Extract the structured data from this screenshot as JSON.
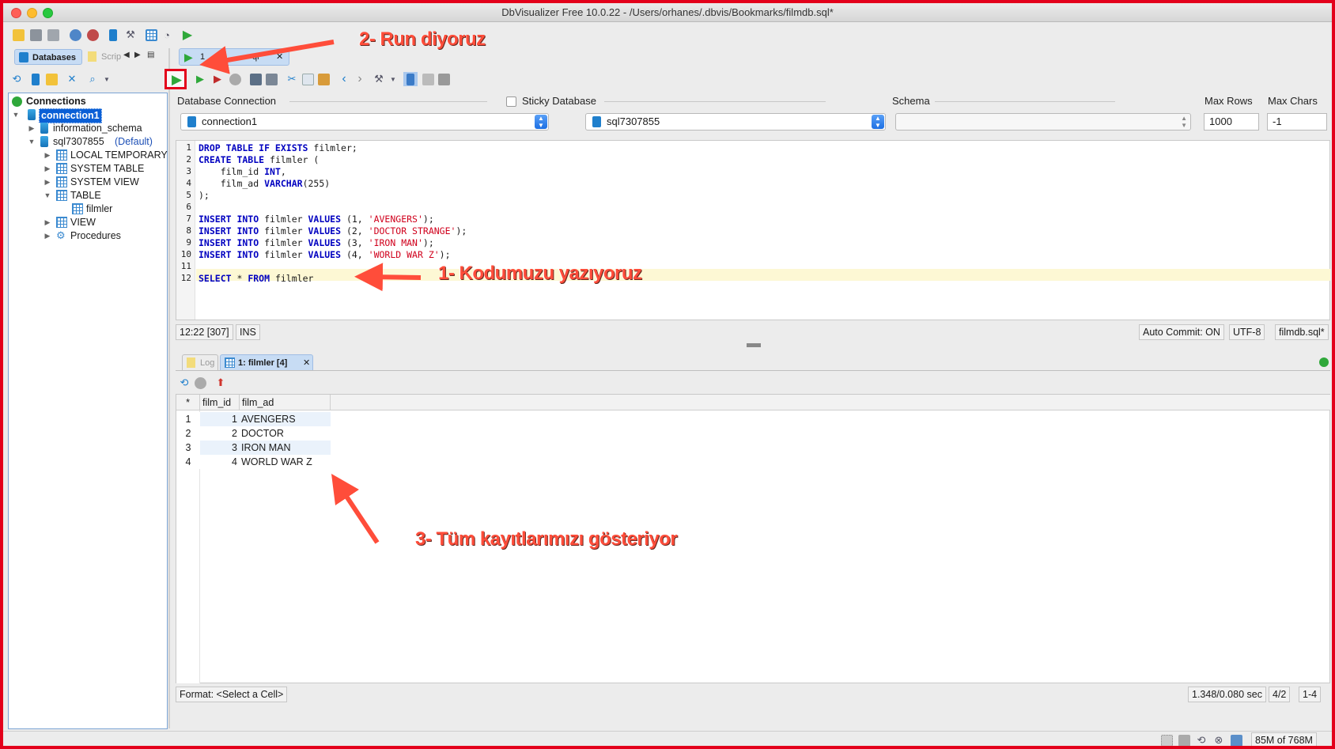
{
  "window": {
    "title": "DbVisualizer Free 10.0.22 - /Users/orhanes/.dbvis/Bookmarks/filmdb.sql*"
  },
  "left_tabs": {
    "databases": "Databases",
    "scripts": "Scrip"
  },
  "tree": {
    "root": "Connections",
    "connection": "connection1",
    "schema1": "information_schema",
    "schema2": "sql7307855",
    "schema2_default": "(Default)",
    "items": [
      "LOCAL TEMPORARY",
      "SYSTEM TABLE",
      "SYSTEM VIEW",
      "TABLE",
      "VIEW",
      "Procedures"
    ],
    "table_child": "filmler"
  },
  "editor_tab": {
    "label": "1",
    "label_suffix": "ql"
  },
  "connection_bar": {
    "database_connection_label": "Database Connection",
    "database_connection_value": "connection1",
    "sticky_label": "Sticky Database",
    "database_value": "sql7307855",
    "schema_label": "Schema",
    "schema_value": "",
    "max_rows_label": "Max Rows",
    "max_rows_value": "1000",
    "max_chars_label": "Max Chars",
    "max_chars_value": "-1"
  },
  "editor": {
    "line_numbers": [
      "1",
      "2",
      "3",
      "4",
      "5",
      "6",
      "7",
      "8",
      "9",
      "10",
      "11",
      "12"
    ],
    "lines": [
      [
        {
          "k": "DROP TABLE IF EXISTS"
        },
        {
          "t": " filmler;"
        }
      ],
      [
        {
          "k": "CREATE TABLE"
        },
        {
          "t": " filmler ("
        }
      ],
      [
        {
          "t": "    film_id "
        },
        {
          "k": "INT"
        },
        {
          "t": ","
        }
      ],
      [
        {
          "t": "    film_ad "
        },
        {
          "k": "VARCHAR"
        },
        {
          "t": "(255)"
        }
      ],
      [
        {
          "t": ");"
        }
      ],
      [],
      [
        {
          "k": "INSERT INTO"
        },
        {
          "t": " filmler "
        },
        {
          "k": "VALUES"
        },
        {
          "t": " (1, "
        },
        {
          "s": "'AVENGERS'"
        },
        {
          "t": ");"
        }
      ],
      [
        {
          "k": "INSERT INTO"
        },
        {
          "t": " filmler "
        },
        {
          "k": "VALUES"
        },
        {
          "t": " (2, "
        },
        {
          "s": "'DOCTOR STRANGE'"
        },
        {
          "t": ");"
        }
      ],
      [
        {
          "k": "INSERT INTO"
        },
        {
          "t": " filmler "
        },
        {
          "k": "VALUES"
        },
        {
          "t": " (3, "
        },
        {
          "s": "'IRON MAN'"
        },
        {
          "t": ");"
        }
      ],
      [
        {
          "k": "INSERT INTO"
        },
        {
          "t": " filmler "
        },
        {
          "k": "VALUES"
        },
        {
          "t": " (4, "
        },
        {
          "s": "'WORLD WAR Z'"
        },
        {
          "t": ");"
        }
      ],
      [],
      [
        {
          "k": "SELECT"
        },
        {
          "t": " * "
        },
        {
          "k": "FROM"
        },
        {
          "t": " filmler"
        }
      ]
    ]
  },
  "editor_status": {
    "position": "12:22 [307]",
    "mode": "INS",
    "auto_commit": "Auto Commit: ON",
    "encoding": "UTF-8",
    "file": "filmdb.sql*"
  },
  "result_tabs": {
    "log": "Log",
    "result": "1: filmler [4]"
  },
  "grid": {
    "corner": "*",
    "columns": [
      "film_id",
      "film_ad"
    ],
    "rows": [
      {
        "num": "1",
        "film_id": "1",
        "film_ad": "AVENGERS"
      },
      {
        "num": "2",
        "film_id": "2",
        "film_ad": "DOCTOR STRANGE"
      },
      {
        "num": "3",
        "film_id": "3",
        "film_ad": "IRON MAN"
      },
      {
        "num": "4",
        "film_id": "4",
        "film_ad": "WORLD WAR Z"
      }
    ]
  },
  "result_status": {
    "format": "Format: <Select a Cell>",
    "timing": "1.348/0.080 sec",
    "page": "4/2",
    "range": "1-4"
  },
  "bottom_status": {
    "memory": "85M of 768M"
  },
  "annotations": {
    "step1": "1- Kodumuzu yazıyoruz",
    "step2": "2- Run diyoruz",
    "step3": "3- Tüm kayıtlarımızı gösteriyor"
  },
  "colors": {
    "annotation": "#ff4d3a",
    "frame": "#e3001b",
    "selection": "#0a5fd6",
    "keyword": "#0000c0",
    "string": "#d0001c"
  }
}
